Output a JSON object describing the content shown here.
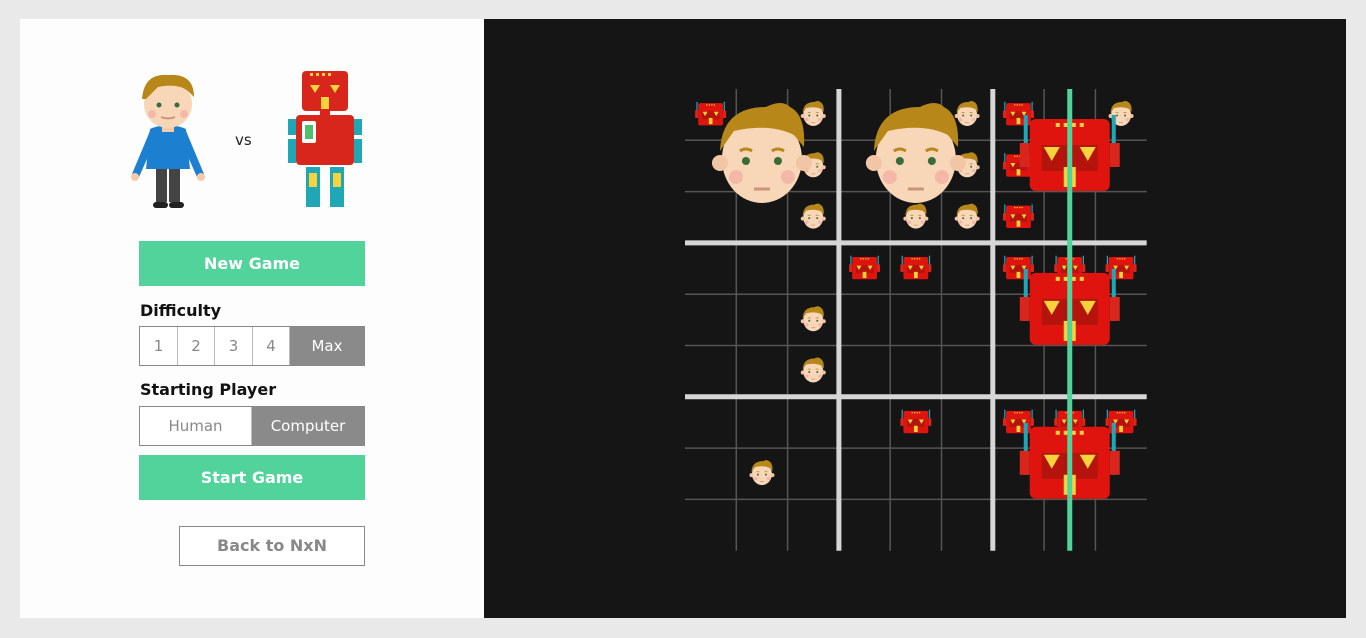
{
  "panel": {
    "vs_text": "vs",
    "new_game_label": "New Game",
    "difficulty_label": "Difficulty",
    "difficulty_options": [
      "1",
      "2",
      "3",
      "4",
      "Max"
    ],
    "difficulty_selected": "Max",
    "starting_player_label": "Starting Player",
    "starting_options": [
      "Human",
      "Computer"
    ],
    "starting_selected": "Computer",
    "start_game_label": "Start Game",
    "back_label": "Back to NxN"
  },
  "board": {
    "winning_line_color": "#52d39b",
    "macro_winners": [
      [
        "human",
        "human",
        "robot"
      ],
      [
        null,
        null,
        "robot"
      ],
      [
        null,
        null,
        "robot"
      ]
    ],
    "cells": [
      [
        "robot",
        null,
        "human",
        null,
        null,
        "human",
        "robot",
        null,
        "human"
      ],
      [
        null,
        null,
        "human",
        null,
        null,
        "human",
        "robot",
        null,
        null
      ],
      [
        null,
        null,
        "human",
        null,
        "human",
        "human",
        "robot",
        null,
        null
      ],
      [
        null,
        null,
        null,
        "robot",
        "robot",
        null,
        "robot",
        "robot",
        "robot"
      ],
      [
        null,
        null,
        "human",
        null,
        null,
        null,
        null,
        "robot",
        null
      ],
      [
        null,
        null,
        "human",
        null,
        null,
        null,
        null,
        null,
        null
      ],
      [
        null,
        null,
        null,
        null,
        "robot",
        null,
        "robot",
        "robot",
        "robot"
      ],
      [
        null,
        "human",
        null,
        null,
        null,
        null,
        null,
        null,
        null
      ],
      [
        null,
        null,
        null,
        null,
        null,
        null,
        null,
        null,
        null
      ]
    ]
  }
}
